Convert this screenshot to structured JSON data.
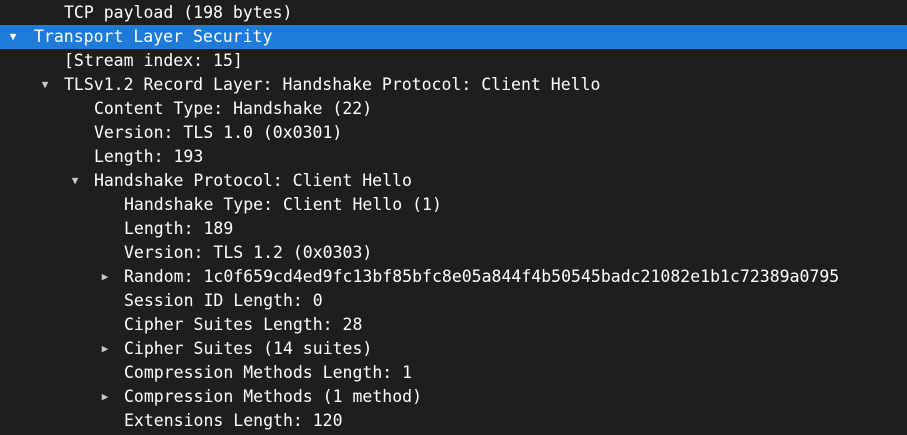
{
  "tree": {
    "rows": [
      {
        "text": "TCP payload (198 bytes)",
        "expander": "none",
        "selected": false
      },
      {
        "text": "Transport Layer Security",
        "expander": "expanded",
        "selected": true
      },
      {
        "text": "[Stream index: 15]",
        "expander": "none",
        "selected": false
      },
      {
        "text": "TLSv1.2 Record Layer: Handshake Protocol: Client Hello",
        "expander": "expanded",
        "selected": false
      },
      {
        "text": "Content Type: Handshake (22)",
        "expander": "none",
        "selected": false
      },
      {
        "text": "Version: TLS 1.0 (0x0301)",
        "expander": "none",
        "selected": false
      },
      {
        "text": "Length: 193",
        "expander": "none",
        "selected": false
      },
      {
        "text": "Handshake Protocol: Client Hello",
        "expander": "expanded",
        "selected": false
      },
      {
        "text": "Handshake Type: Client Hello (1)",
        "expander": "none",
        "selected": false
      },
      {
        "text": "Length: 189",
        "expander": "none",
        "selected": false
      },
      {
        "text": "Version: TLS 1.2 (0x0303)",
        "expander": "none",
        "selected": false
      },
      {
        "text": "Random: 1c0f659cd4ed9fc13bf85bfc8e05a844f4b50545badc21082e1b1c72389a0795",
        "expander": "collapsed",
        "selected": false
      },
      {
        "text": "Session ID Length: 0",
        "expander": "none",
        "selected": false
      },
      {
        "text": "Cipher Suites Length: 28",
        "expander": "none",
        "selected": false
      },
      {
        "text": "Cipher Suites (14 suites)",
        "expander": "collapsed",
        "selected": false
      },
      {
        "text": "Compression Methods Length: 1",
        "expander": "none",
        "selected": false
      },
      {
        "text": "Compression Methods (1 method)",
        "expander": "collapsed",
        "selected": false
      },
      {
        "text": "Extensions Length: 120",
        "expander": "none",
        "selected": false
      }
    ]
  },
  "colors": {
    "background": "#1e1e1e",
    "selection": "#1e7bd9",
    "text": "#ffffff"
  }
}
